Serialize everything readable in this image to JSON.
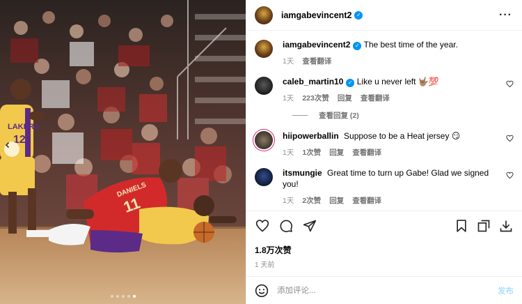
{
  "post": {
    "username": "iamgabevincent2",
    "verified_mark": "✓",
    "more_label": "···",
    "caption": "The best time of the year.",
    "caption_time": "1天",
    "caption_translate": "查看翻译",
    "likes": "1.8万次赞",
    "posted_ago": "1 天前"
  },
  "media": {
    "jersey_number_1": "12",
    "jersey_team": "LAKERS",
    "jersey_name_2": "DANIELS",
    "jersey_number_2": "11",
    "slide_count": 5,
    "active_slide": 5
  },
  "comments": [
    {
      "user": "caleb_martin10",
      "verified": true,
      "text": "Like u never left 🤟🏽💯",
      "time": "1天",
      "likes": "223次赞",
      "reply": "回复",
      "translate": "查看翻译",
      "view_replies": "查看回复 (2)"
    },
    {
      "user": "hiipowerballin",
      "verified": false,
      "text": "Suppose to be a Heat jersey 😏",
      "time": "1天",
      "likes": "1次赞",
      "reply": "回复",
      "translate": "查看翻译"
    },
    {
      "user": "itsmungie",
      "verified": false,
      "text": "Great time to turn up Gabe! Glad we signed you!",
      "time": "1天",
      "likes": "2次赞",
      "reply": "回复",
      "translate": "查看翻译"
    }
  ],
  "composer": {
    "placeholder": "添加评论...",
    "post_label": "发布"
  },
  "icons": [
    "heart-icon",
    "comment-icon",
    "share-icon",
    "bookmark-icon",
    "repost-icon",
    "download-icon",
    "emoji-icon",
    "verified-icon",
    "more-icon"
  ]
}
